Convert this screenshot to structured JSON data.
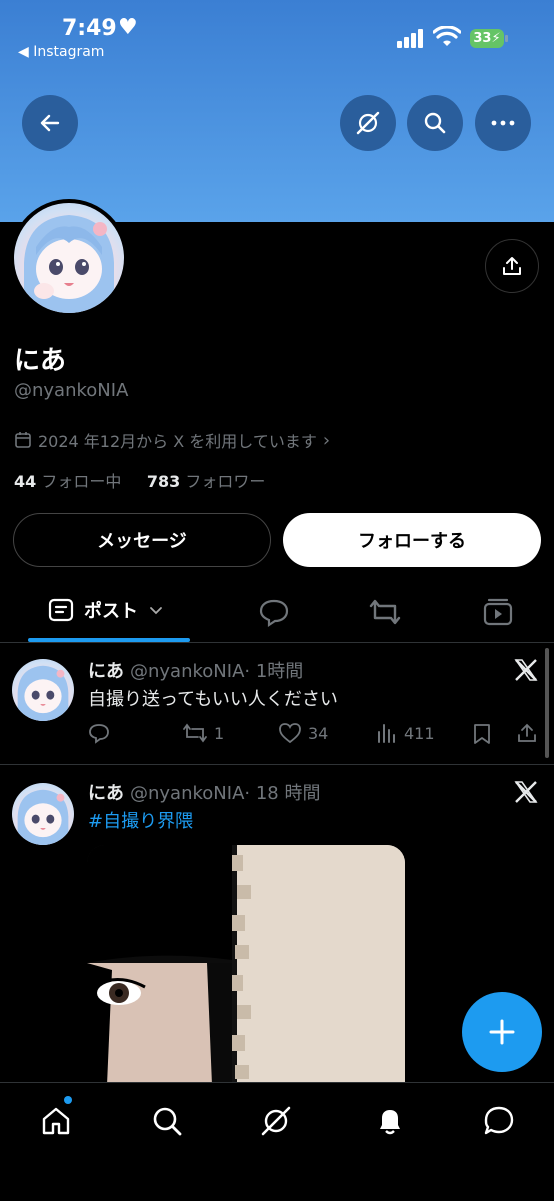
{
  "status_bar": {
    "time": "7:49",
    "back_app": "◀ Instagram",
    "battery": "33"
  },
  "profile": {
    "name": "にあ",
    "handle": "@nyankoNIA",
    "joined": "2024 年12月から X を利用しています",
    "following_count": "44",
    "following_label": "フォロー中",
    "followers_count": "783",
    "followers_label": "フォロワー",
    "message_label": "メッセージ",
    "follow_label": "フォローする"
  },
  "tabs": {
    "posts_label": "ポスト"
  },
  "posts": [
    {
      "name": "にあ",
      "handle": "@nyankoNIA",
      "time": "· 1時間",
      "text": "自撮り送ってもいい人ください",
      "retweets": "1",
      "likes": "34",
      "views": "411"
    },
    {
      "name": "にあ",
      "handle": "@nyankoNIA",
      "time": "· 18 時間",
      "hashtag": "#自撮り界隈"
    }
  ],
  "colors": {
    "accent": "#1d9bf0",
    "banner": "#4a90e2",
    "background": "#000000"
  }
}
